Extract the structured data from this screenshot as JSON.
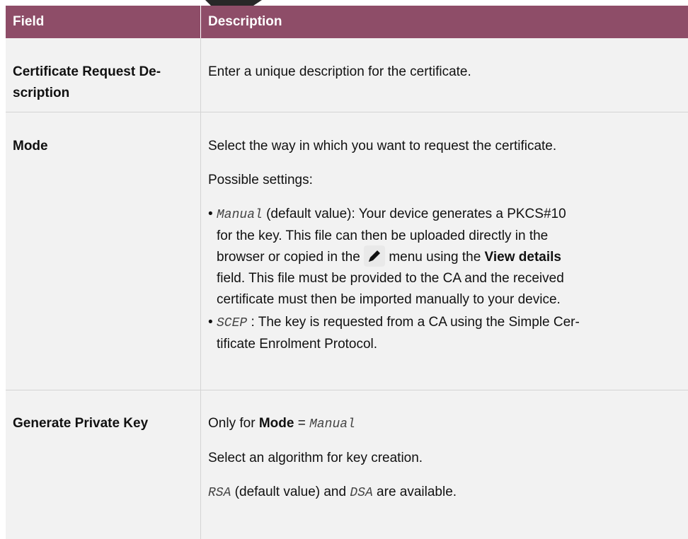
{
  "header": {
    "field_label": "Field",
    "description_label": "Description"
  },
  "rows": [
    {
      "field": [
        "Certificate Request De-",
        "scription"
      ],
      "description": "Enter a unique description for the certificate."
    },
    {
      "field": "Mode",
      "intro": "Select the way in which you want to request the certificate.",
      "possible": "Possible settings:",
      "bullets": [
        {
          "value": "Manual",
          "text_a": " (default value): Your device generates a PKCS#10",
          "line2": "for the key. This file can then be uploaded directly in the",
          "line3_a": "browser or copied in the",
          "line3_b": " menu using the",
          "line3_bold": "View details",
          "line4": "field. This file must be provided to the CA and the received",
          "line5": "certificate must then be imported manually to your device.",
          "icon": "pencil-edit-icon"
        },
        {
          "value": "SCEP",
          "text_a": " : The key is requested from a CA using the Simple Cer-",
          "line2": "tificate Enrolment Protocol."
        }
      ]
    },
    {
      "field": "Generate Private Key",
      "only_for_prefix": "Only for ",
      "only_for_bold": "Mode",
      "only_for_eq": " = ",
      "only_for_value": "Manual",
      "select_text": "Select an algorithm for key creation.",
      "rsa": "RSA",
      "rsa_text": " (default value) and ",
      "dsa": "DSA",
      "dsa_text": " are available."
    }
  ],
  "colors": {
    "header_bg": "#8e4d68",
    "row_bg": "#f2f2f2"
  }
}
